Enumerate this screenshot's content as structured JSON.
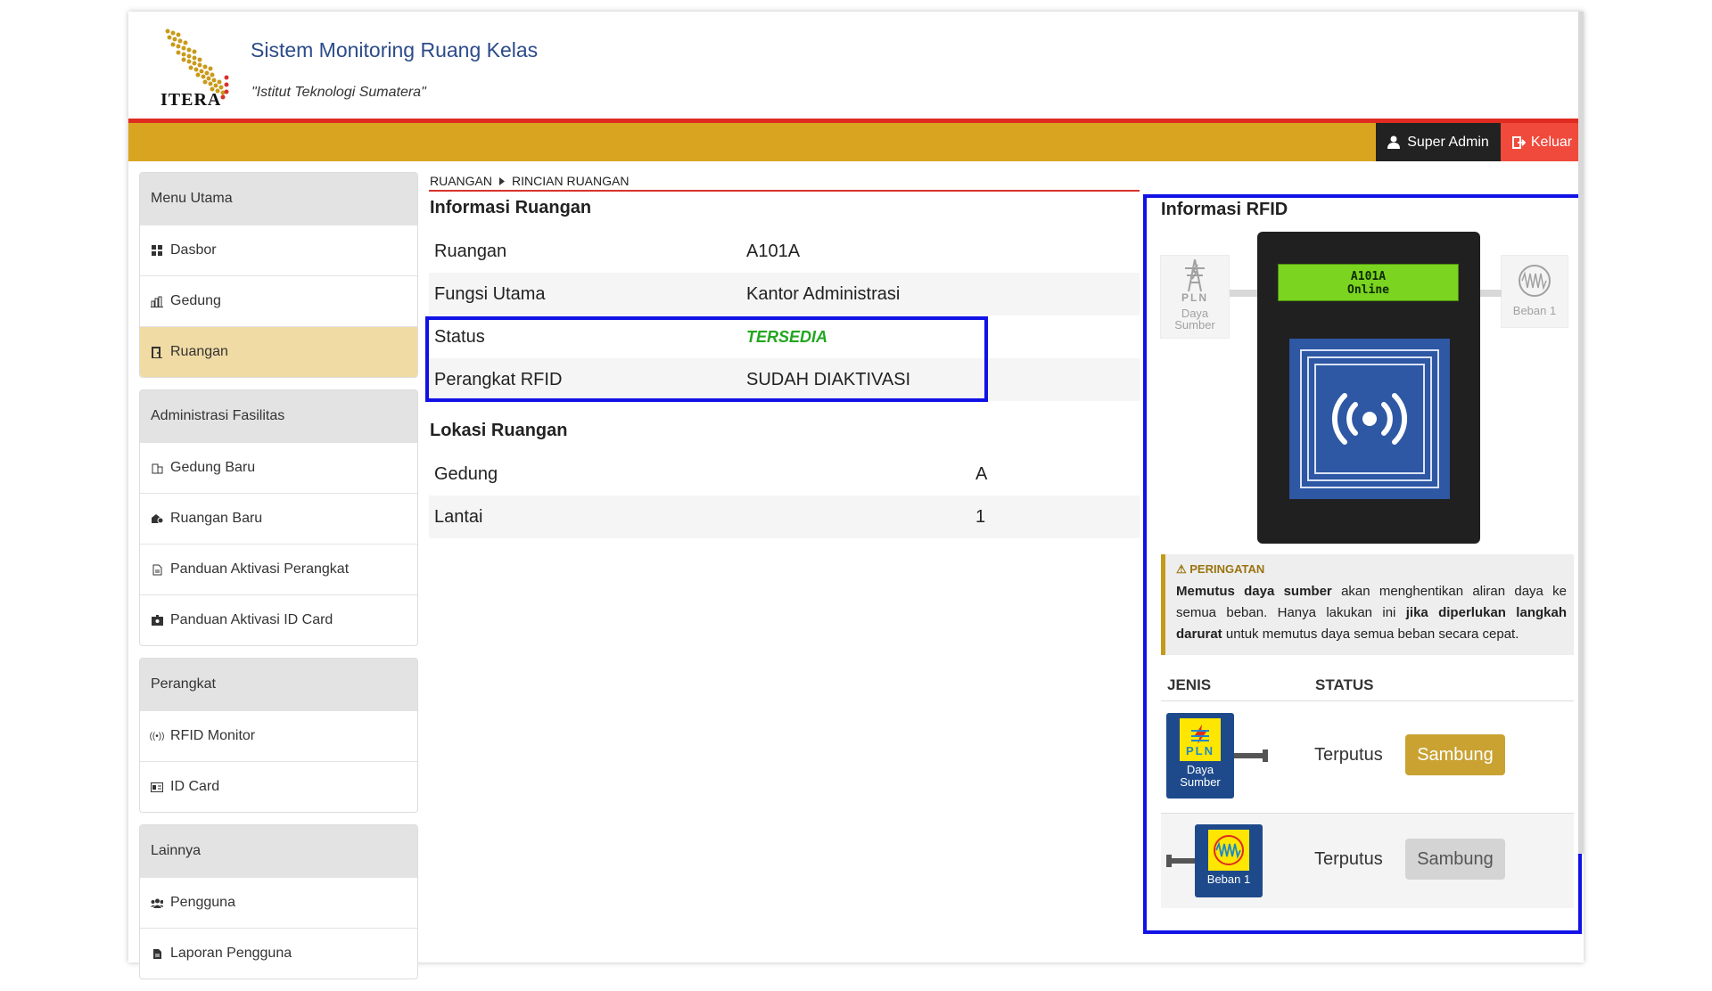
{
  "header": {
    "logo_text": "ITERA",
    "title": "Sistem Monitoring Ruang Kelas",
    "subtitle": "\"Istitut Teknologi Sumatera\""
  },
  "topbar": {
    "user_label": "Super Admin",
    "logout_label": "Keluar",
    "colors": {
      "bar": "#d9a521",
      "accent_line": "#e02b20",
      "user_bg": "#222222",
      "logout_bg": "#f04a3c"
    }
  },
  "sidebar": {
    "groups": [
      {
        "title": "Menu Utama",
        "items": [
          {
            "label": "Dasbor",
            "icon": "dashboard-icon"
          },
          {
            "label": "Gedung",
            "icon": "building-chart-icon"
          },
          {
            "label": "Ruangan",
            "icon": "door-icon",
            "active": true
          }
        ]
      },
      {
        "title": "Administrasi Fasilitas",
        "items": [
          {
            "label": "Gedung Baru",
            "icon": "building-add-icon"
          },
          {
            "label": "Ruangan Baru",
            "icon": "room-add-icon"
          },
          {
            "label": "Panduan Aktivasi Perangkat",
            "icon": "document-icon"
          },
          {
            "label": "Panduan Aktivasi ID Card",
            "icon": "id-badge-icon"
          }
        ]
      },
      {
        "title": "Perangkat",
        "items": [
          {
            "label": "RFID Monitor",
            "icon": "rfid-icon"
          },
          {
            "label": "ID Card",
            "icon": "id-card-icon"
          }
        ]
      },
      {
        "title": "Lainnya",
        "items": [
          {
            "label": "Pengguna",
            "icon": "users-icon"
          },
          {
            "label": "Laporan Pengguna",
            "icon": "report-icon"
          }
        ]
      }
    ]
  },
  "breadcrumb": {
    "items": [
      "RUANGAN",
      "RINCIAN RUANGAN"
    ]
  },
  "informasi_ruangan": {
    "title": "Informasi Ruangan",
    "rows": [
      {
        "label": "Ruangan",
        "value": "A101A"
      },
      {
        "label": "Fungsi Utama",
        "value": "Kantor Administrasi"
      },
      {
        "label": "Status",
        "value": "TERSEDIA"
      },
      {
        "label": "Perangkat RFID",
        "value": "SUDAH DIAKTIVASI"
      }
    ]
  },
  "lokasi_ruangan": {
    "title": "Lokasi Ruangan",
    "rows": [
      {
        "label": "Gedung",
        "value": "A"
      },
      {
        "label": "Lantai",
        "value": "1"
      }
    ]
  },
  "rfid": {
    "title": "Informasi RFID",
    "source_label": "PLN",
    "source_caption_1": "Daya",
    "source_caption_2": "Sumber",
    "load_caption": "Beban 1",
    "lcd_line1": "A101A",
    "lcd_line2": "Online",
    "warning_title": "⚠ PERINGATAN",
    "warning_parts": [
      "Memutus daya sumber",
      " akan menghentikan aliran daya ke semua beban. Hanya lakukan ini ",
      "jika diperlukan langkah darurat",
      " untuk memutus daya semua beban secara cepat."
    ],
    "table_headers": {
      "jenis": "JENIS",
      "status": "STATUS"
    },
    "loads": [
      {
        "tile_caption_1": "Daya",
        "tile_caption_2": "Sumber",
        "tile_label": "PLN",
        "status": "Terputus",
        "button": "Sambung",
        "enabled": true
      },
      {
        "tile_caption_1": "Beban 1",
        "status": "Terputus",
        "button": "Sambung",
        "enabled": false
      }
    ],
    "colors": {
      "lcd": "#7bd420",
      "reader": "#2e57a4",
      "button_active": "#c9a232",
      "highlight": "#1111e6"
    }
  }
}
